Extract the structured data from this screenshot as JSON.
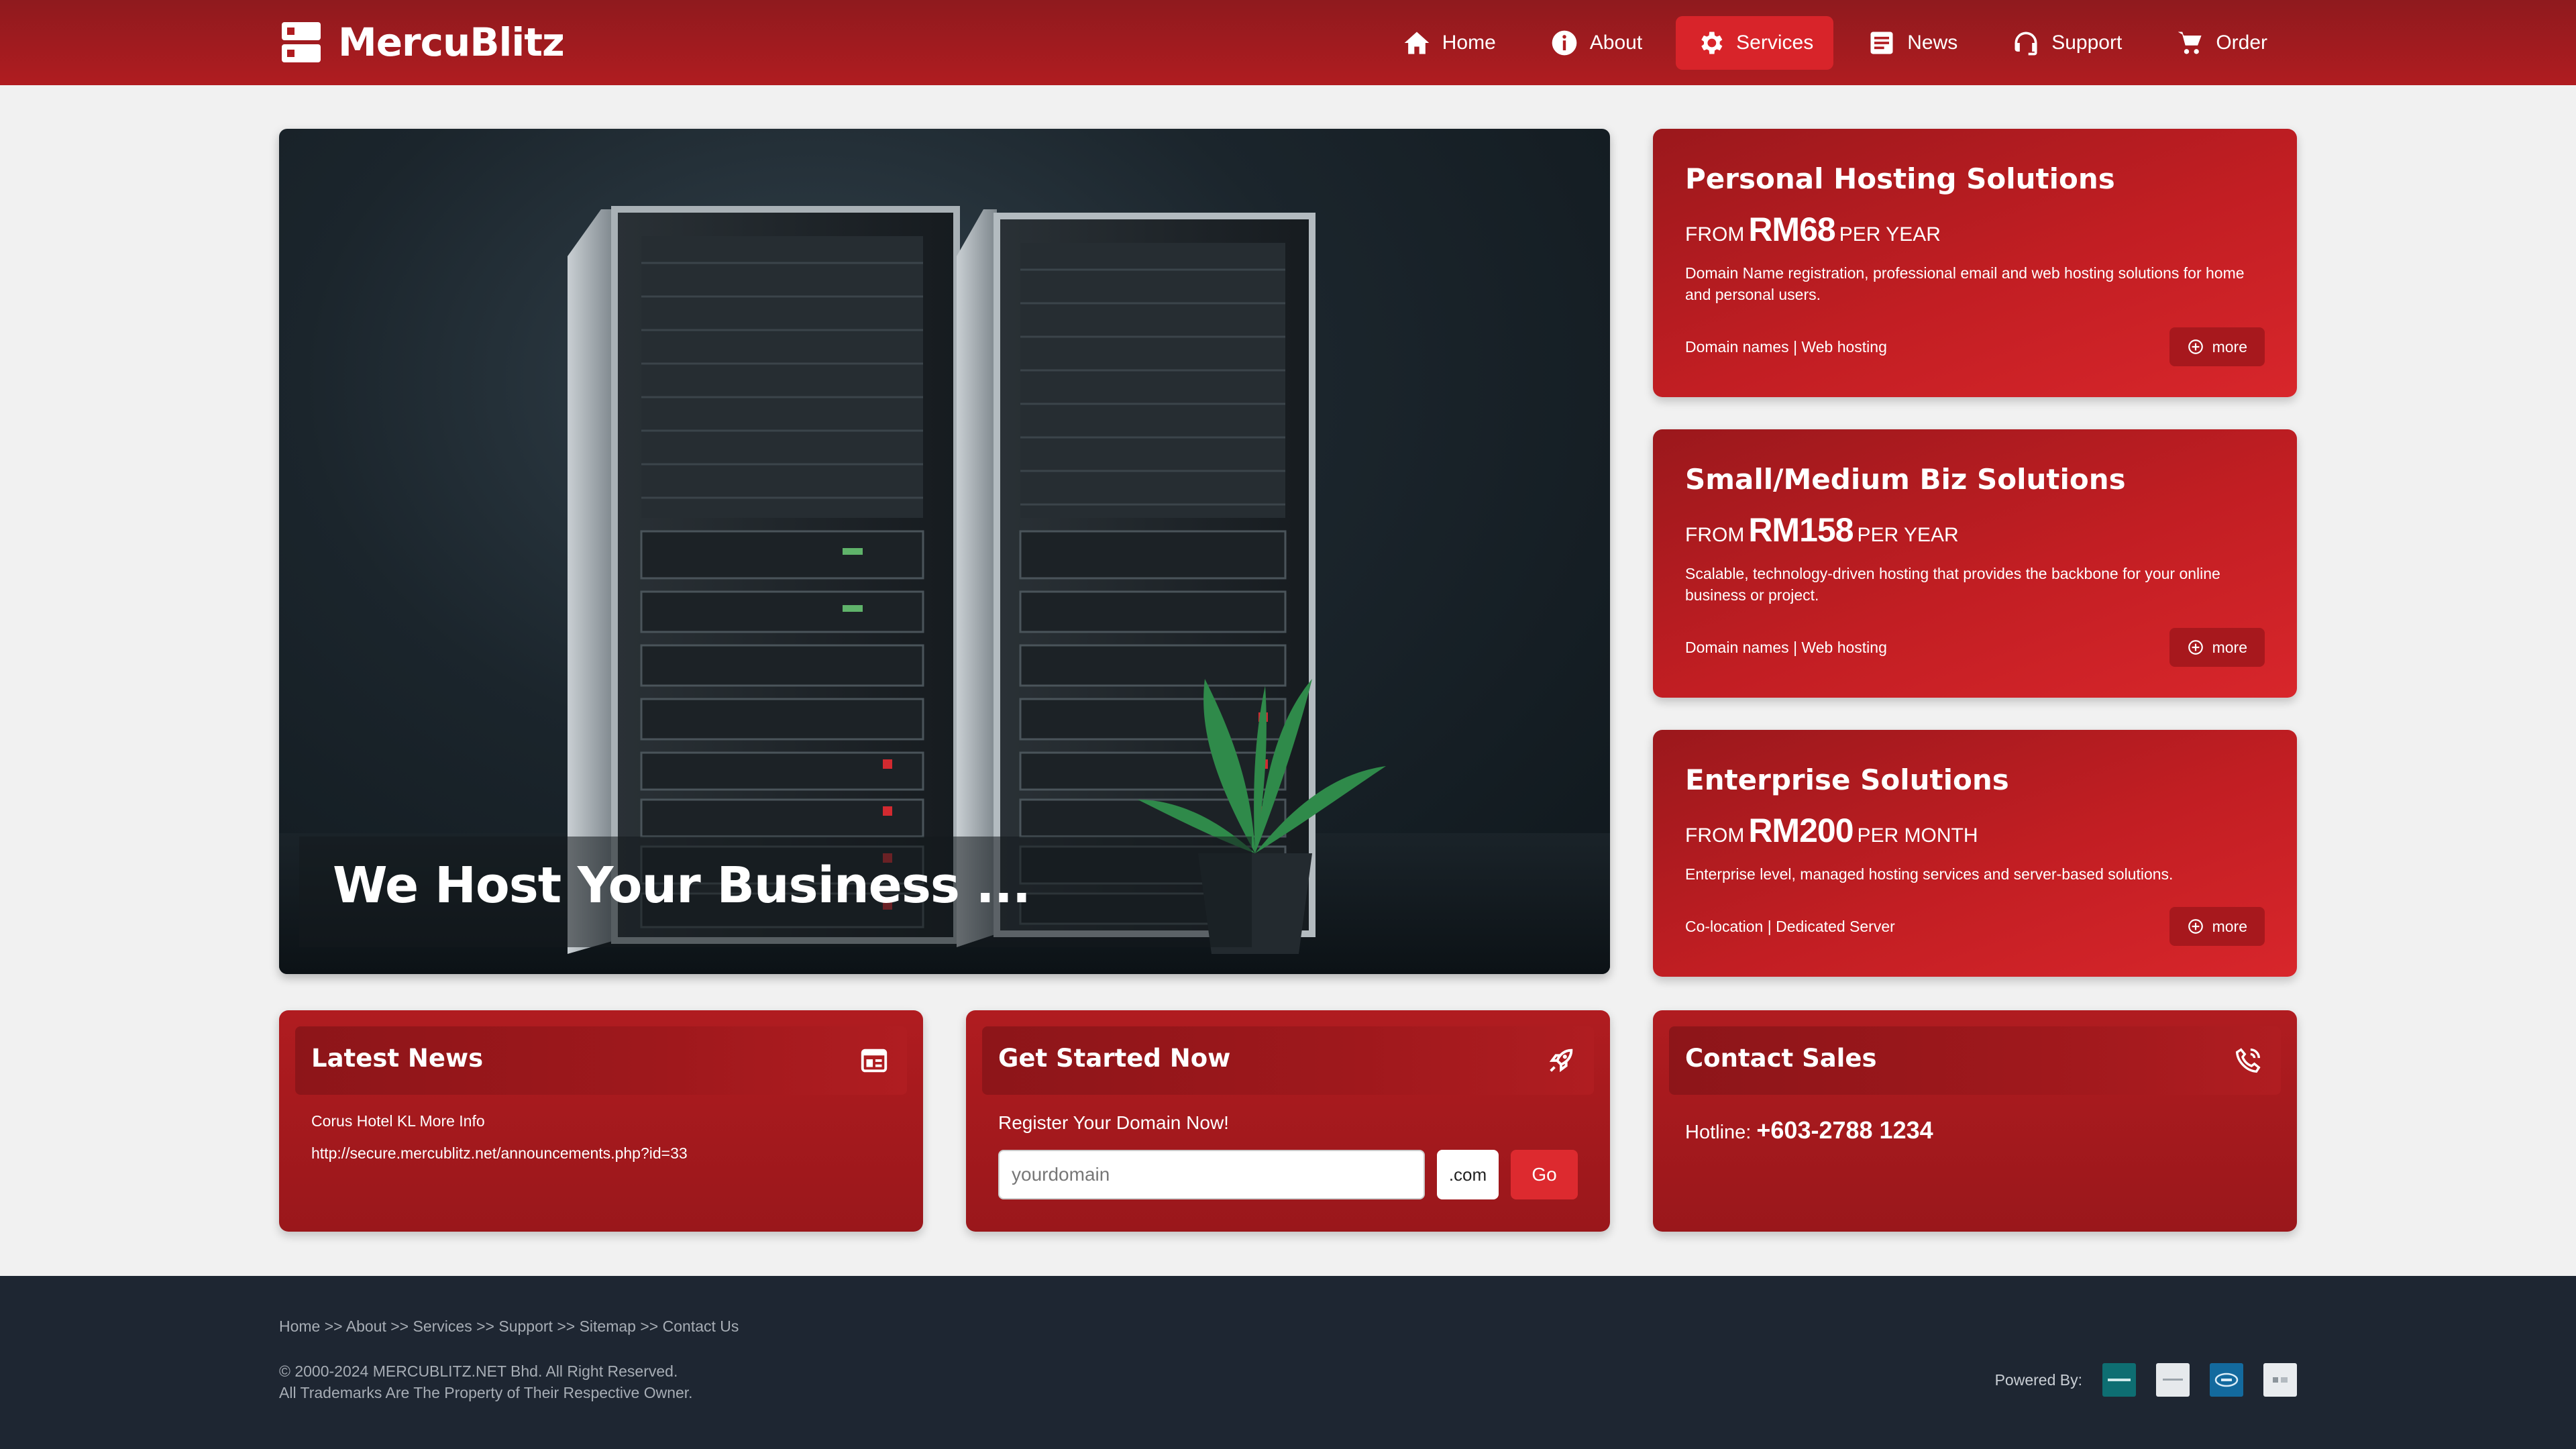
{
  "brand": {
    "name": "MercuBlitz"
  },
  "nav": {
    "items": [
      {
        "label": "Home",
        "icon": "home-icon"
      },
      {
        "label": "About",
        "icon": "info-icon"
      },
      {
        "label": "Services",
        "icon": "gear-icon",
        "active": true
      },
      {
        "label": "News",
        "icon": "newspaper-icon"
      },
      {
        "label": "Support",
        "icon": "headset-icon"
      },
      {
        "label": "Order",
        "icon": "cart-icon"
      }
    ]
  },
  "hero": {
    "title": "We Host Your Business ..."
  },
  "plans": [
    {
      "title": "Personal Hosting Solutions",
      "from": "FROM",
      "price": "RM68",
      "period": "PER YEAR",
      "description": "Domain Name registration, professional email and web hosting solutions for home and personal users.",
      "links": "Domain names | Web hosting",
      "more_label": "more"
    },
    {
      "title": "Small/Medium Biz Solutions",
      "from": "FROM",
      "price": "RM158",
      "period": "PER YEAR",
      "description": "Scalable, technology-driven hosting that provides the backbone for your online business or project.",
      "links": "Domain names | Web hosting",
      "more_label": "more"
    },
    {
      "title": "Enterprise Solutions",
      "from": "FROM",
      "price": "RM200",
      "period": "PER MONTH",
      "description": "Enterprise level, managed hosting services and server-based solutions.",
      "links": "Co-location | Dedicated Server",
      "more_label": "more"
    }
  ],
  "news": {
    "title": "Latest News",
    "items": [
      "Corus Hotel KL More Info",
      "http://secure.mercublitz.net/announcements.php?id=33"
    ]
  },
  "get_started": {
    "title": "Get Started Now",
    "label": "Register Your Domain Now!",
    "placeholder": "yourdomain",
    "tld": ".com",
    "go_label": "Go"
  },
  "contact": {
    "title": "Contact Sales",
    "hotline_label": "Hotline:",
    "hotline_number": "+603-2788 1234"
  },
  "footer": {
    "breadcrumb": [
      "Home",
      "About",
      "Services",
      "Support",
      "Sitemap",
      "Contact Us"
    ],
    "separator": ">>",
    "copyright": "© 2000-2024 MERCUBLITZ.NET Bhd. All Right Reserved.",
    "trademarks": "All Trademarks Are The Property of Their Respective Owner.",
    "powered_by": "Powered By:"
  },
  "colors": {
    "header": "#b01c20",
    "accent": "#dd2a2f",
    "card": "#c21e23",
    "footer": "#1e2632",
    "page_bg": "#f1f1f1"
  }
}
